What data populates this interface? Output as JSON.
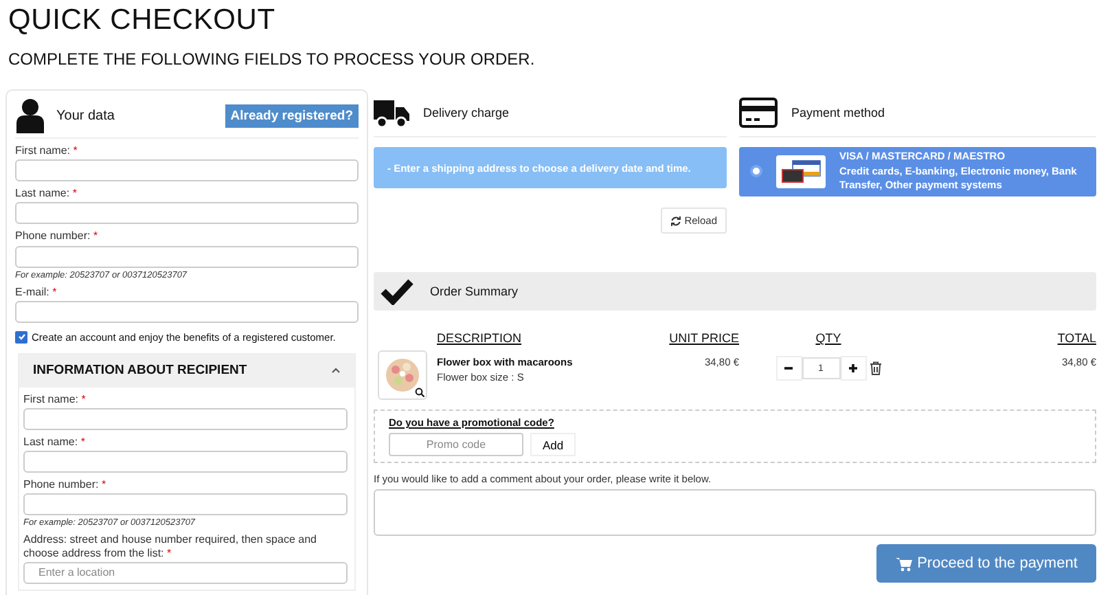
{
  "page": {
    "title": "QUICK CHECKOUT",
    "subtitle": "COMPLETE THE FOLLOWING FIELDS TO PROCESS YOUR ORDER."
  },
  "your_data": {
    "title": "Your data",
    "login_button": "Already registered?",
    "fields": [
      {
        "label": "First name:",
        "mark": "*"
      },
      {
        "label": "Last name:",
        "mark": "*"
      },
      {
        "label": "Phone number:",
        "mark": "*",
        "hint": "For example: 20523707 or 0037120523707"
      },
      {
        "label": "E-mail:",
        "mark": "*"
      }
    ],
    "account_checkbox": {
      "label": "Create an account and enjoy the benefits of a registered customer.",
      "checked": true
    }
  },
  "recipient": {
    "title": "INFORMATION ABOUT RECIPIENT",
    "expanded": true,
    "fields": [
      {
        "label": "First name:",
        "mark": "*"
      },
      {
        "label": "Last name:",
        "mark": "*"
      },
      {
        "label": "Phone number:",
        "mark": "*",
        "hint": "For example: 20523707 or 0037120523707"
      },
      {
        "label": "Address: street and house number required, then space and choose address from the list:",
        "mark": "*",
        "placeholder": "Enter a location"
      }
    ]
  },
  "delivery": {
    "title": "Delivery charge",
    "notice": "- Enter a shipping address to choose a delivery date and time.",
    "reload_button": "Reload"
  },
  "payment": {
    "title": "Payment method",
    "methods": [
      {
        "name": "VISA / MASTERCARD / MAESTRO",
        "description": "Credit cards, E-banking, Electronic money, Bank Transfer, Other payment systems",
        "selected": true
      }
    ]
  },
  "order_summary": {
    "title": "Order Summary",
    "columns": [
      "DESCRIPTION",
      "UNIT PRICE",
      "QTY",
      "TOTAL"
    ],
    "items": [
      {
        "name": "Flower box with macaroons",
        "option": "Flower box size : S",
        "unit_price": "34,80 €",
        "quantity": "1",
        "total": "34,80 €"
      }
    ]
  },
  "promo": {
    "question": "Do you have a promotional code?",
    "placeholder": "Promo code",
    "add_button": "Add"
  },
  "comment": {
    "label": "If you would like to add a comment about your order, please write it below."
  },
  "checkout_button": "Proceed to the payment"
}
